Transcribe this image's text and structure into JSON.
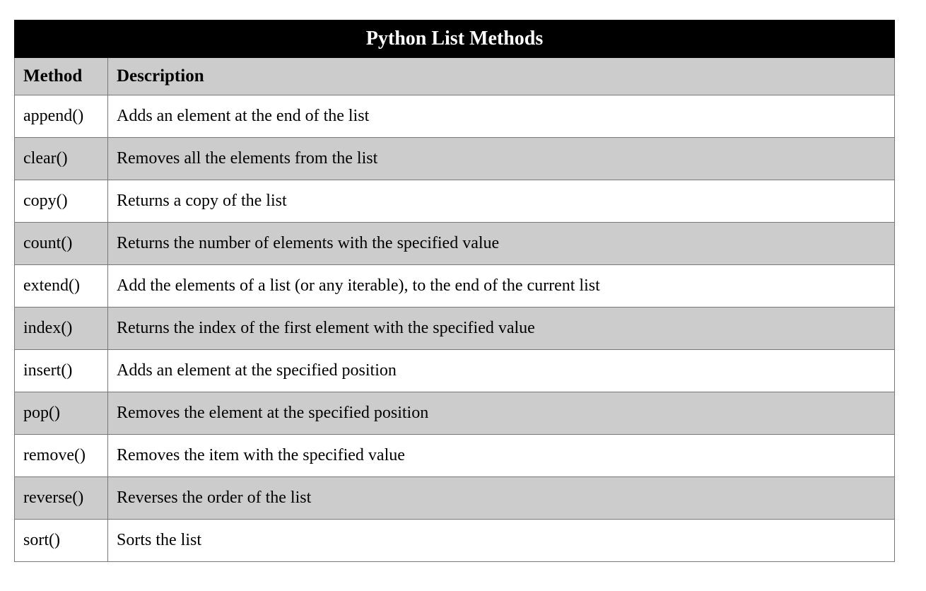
{
  "title": "Python List Methods",
  "headers": {
    "method": "Method",
    "description": "Description"
  },
  "rows": [
    {
      "method": "append()",
      "description": "Adds an element at the end of the list"
    },
    {
      "method": "clear()",
      "description": "Removes all the elements from the list"
    },
    {
      "method": "copy()",
      "description": "Returns a copy of the list"
    },
    {
      "method": "count()",
      "description": "Returns the number of elements with the specified value"
    },
    {
      "method": "extend()",
      "description": "Add the elements of a list (or any iterable), to the end of the current list"
    },
    {
      "method": "index()",
      "description": "Returns the index of the first element with the specified value"
    },
    {
      "method": "insert()",
      "description": "Adds an element at the specified position"
    },
    {
      "method": "pop()",
      "description": "Removes the element at the specified position"
    },
    {
      "method": "remove()",
      "description": "Removes the item with the specified value"
    },
    {
      "method": "reverse()",
      "description": "Reverses the order of the list"
    },
    {
      "method": "sort()",
      "description": "Sorts the list"
    }
  ]
}
